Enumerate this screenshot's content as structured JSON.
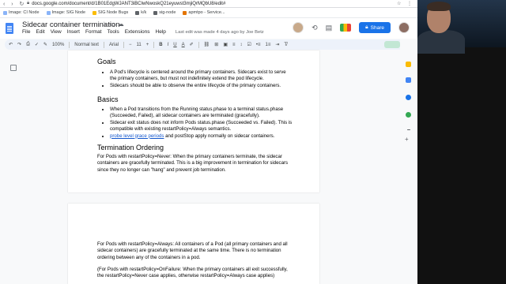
{
  "browser": {
    "url": "docs.google.com/document/d/1B01EdgWJANT3iBClwNwoskQ21eyuwst3mjiQrMQbU8/edit#",
    "bookmarks": [
      "Image: CI Node",
      "Image: SIG Node",
      "SIG Node Bugs",
      "k/k",
      "sig-node",
      "apmtpo - Service..."
    ]
  },
  "header": {
    "doc_title": "Sidecar container termination",
    "menu": [
      "File",
      "Edit",
      "View",
      "Insert",
      "Format",
      "Tools",
      "Extensions",
      "Help"
    ],
    "last_edit": "Last edit was made 4 days ago by Joe Betz",
    "share_label": "Share"
  },
  "toolbar": {
    "zoom": "100%",
    "style": "Normal text",
    "font": "Arial",
    "font_size": "11",
    "bold": "B",
    "italic": "I",
    "underline": "U",
    "text_color": "A"
  },
  "document": {
    "page1": {
      "goals_heading": "Goals",
      "goals_items": [
        "A Pod's lifecycle is centered around the primary containers. Sidecars exist to serve the primary containers, but must not indefinitely extend the pod lifecycle.",
        "Sidecars should be able to observe the entire lifecycle of the primary containers."
      ],
      "basics_heading": "Basics",
      "basics_items": [
        "When a Pod transitions from the Running status.phase to a terminal status.phase (Succeeded, Failed), all sidecar containers are terminated (gracefully).",
        "Sidecar exit status does not inform Pods status.phase (Succeeded vs. Failed). This is compatible with existing restartPolicy=Always semantics."
      ],
      "basics_last_link": "probe level grace periods",
      "basics_last_rest": " and postStop apply normally on sidecar containers.",
      "termination_heading": "Termination Ordering",
      "termination_para": "For Pods with restartPolicy=Never: When the primary containers terminate, the sidecar containers are gracefully terminated. This is a big improvement in termination for sidecars since they no longer can \"hang\" and prevent job termination."
    },
    "page2": {
      "para1": "For Pods with restartPolicy=Always: All containers of a Pod (all primary containers and all sidecar containers) are gracefully terminated at the same time. There is no termination ordering between any of the containers in a pod.",
      "para2": "(For Pods with restartPolicy=OnFailure:  When the primary containers all exit successfully, the restartPolicy=Never case applies, otherwise restartPolicy=Always case applies)"
    }
  },
  "colors": {
    "share_button": "#1a73e8",
    "link": "#1155cc",
    "doc_icon": "#4285f4"
  }
}
